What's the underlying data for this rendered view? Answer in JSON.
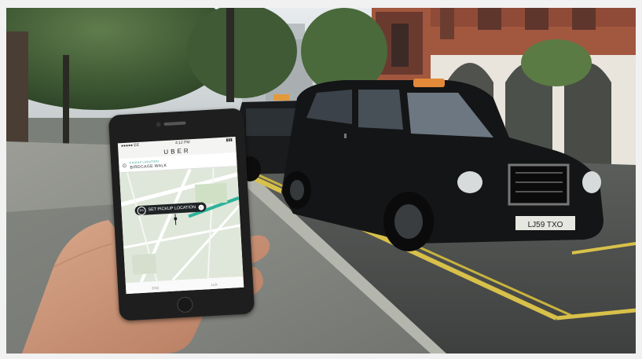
{
  "image": {
    "phone": {
      "status_bar": {
        "carrier": "●●●●● EE",
        "time": "4:12 PM",
        "battery": "▮▮▮"
      },
      "app_name": "UBER",
      "pickup": {
        "caption": "PICKUP LOCATION",
        "place": "BIRDCAGE WALK"
      },
      "map": {
        "set_pickup_label": "SET PICKUP LOCATION",
        "eta": "2m"
      },
      "tabs": [
        "ESQ",
        "LUX"
      ]
    },
    "taxi": {
      "plate": "LJ59 TXO"
    },
    "colors": {
      "road": "#4a4d4b",
      "pavement": "#8a8c86",
      "taxi": "#141516",
      "foliage": "#3d5a33",
      "brick": "#a35a44",
      "yellow_line": "#d8c14a",
      "uber_map_route": "#2cb39a"
    }
  }
}
